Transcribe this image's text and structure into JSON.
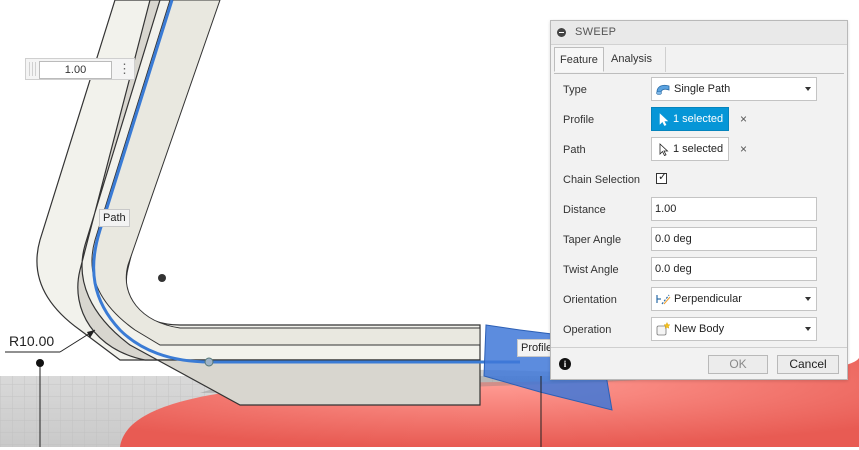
{
  "viewport": {
    "distance_value": "1.00",
    "path_tag": "Path",
    "profile_tag": "Profile",
    "radius_label": "R10.00"
  },
  "dialog": {
    "title": "SWEEP",
    "tabs": [
      "Feature",
      "Analysis"
    ],
    "type": {
      "label": "Type",
      "value": "Single Path",
      "icon": "single-path-icon"
    },
    "profile": {
      "label": "Profile",
      "value": "1 selected",
      "icon": "cursor-arrow-icon"
    },
    "path": {
      "label": "Path",
      "value": "1 selected",
      "icon": "cursor-arrow-icon"
    },
    "chain_selection": {
      "label": "Chain Selection",
      "checked": true,
      "mark": "✓"
    },
    "distance": {
      "label": "Distance",
      "value": "1.00"
    },
    "taper_angle": {
      "label": "Taper Angle",
      "value": "0.0 deg"
    },
    "twist_angle": {
      "label": "Twist Angle",
      "value": "0.0 deg"
    },
    "orientation": {
      "label": "Orientation",
      "value": "Perpendicular",
      "icon": "perpendicular-icon"
    },
    "operation": {
      "label": "Operation",
      "value": "New Body",
      "icon": "new-body-icon"
    },
    "clear_glyph": "×",
    "info_glyph": "i",
    "ok_label": "OK",
    "cancel_label": "Cancel"
  },
  "colors": {
    "accent": "#0696d7",
    "path_line": "#3a7bd5",
    "body": "#ee6a62",
    "profile_fill": "#3f78d8"
  }
}
